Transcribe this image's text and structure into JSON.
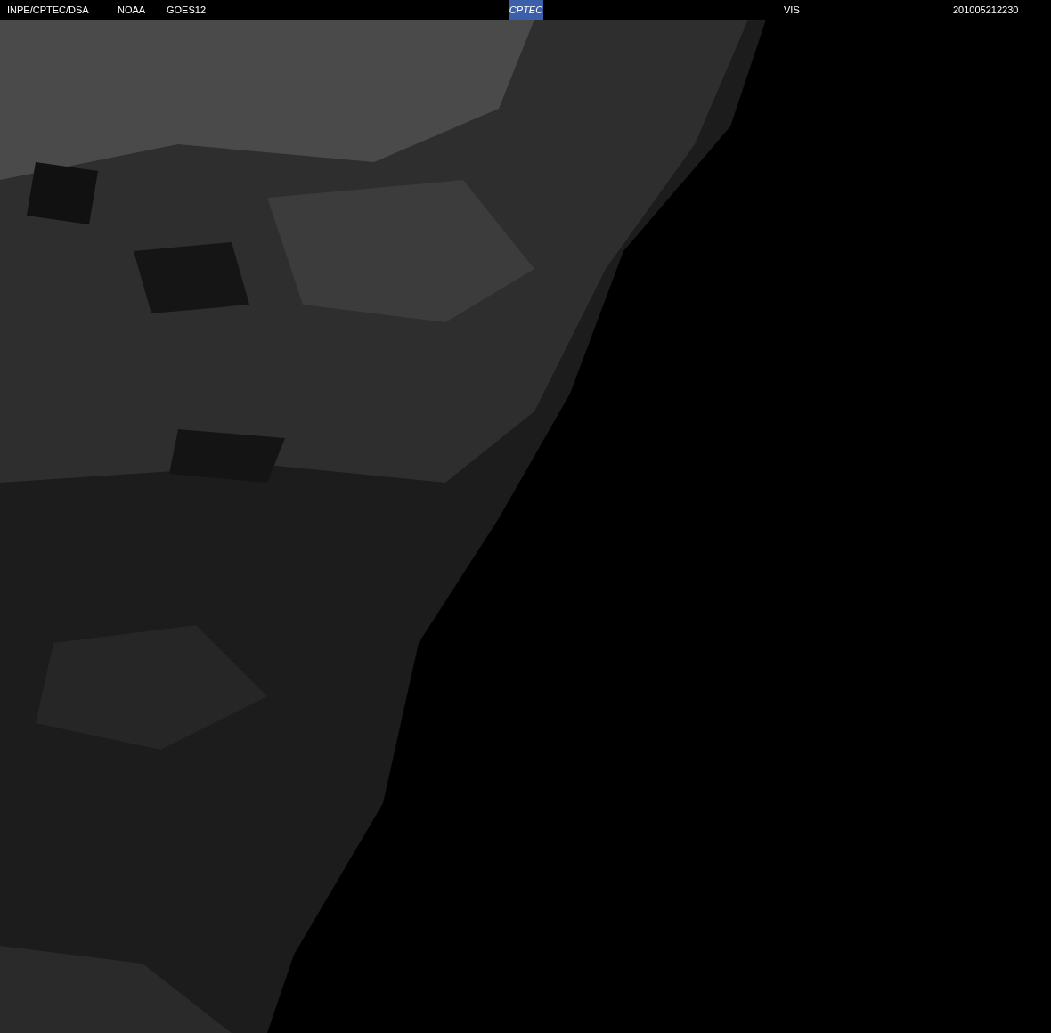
{
  "header": {
    "source": "INPE/CPTEC/DSA",
    "agency": "NOAA",
    "satellite": "GOES12",
    "logo": "CPTEC",
    "channel": "VIS",
    "timestamp": "201005212230"
  }
}
